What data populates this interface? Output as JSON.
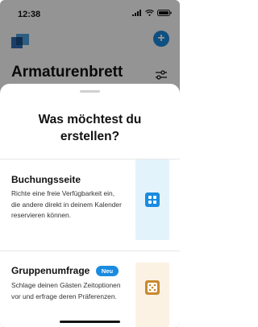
{
  "status_bar": {
    "time": "12:38"
  },
  "background": {
    "page_title": "Armaturenbrett",
    "add_label": "+"
  },
  "sheet": {
    "title_line1": "Was möchtest du",
    "title_line2": "erstellen?",
    "options": [
      {
        "title": "Buchungsseite",
        "description": "Richte eine freie Verfügbarkeit ein,  die andere direkt in deinem Kalender reservieren können.",
        "icon": "grid-icon",
        "icon_bg": "#e3f3fb",
        "icon_color": "#1a8be0"
      },
      {
        "title": "Gruppenumfrage",
        "badge": "Neu",
        "description": "Schlage deinen Gästen Zeitoptionen vor und erfrage deren  Präferenzen.",
        "icon": "dice-icon",
        "icon_bg": "#fbf2e4",
        "icon_color": "#c9892f"
      }
    ]
  },
  "colors": {
    "accent": "#1a8be0",
    "poll_accent": "#c9892f"
  }
}
